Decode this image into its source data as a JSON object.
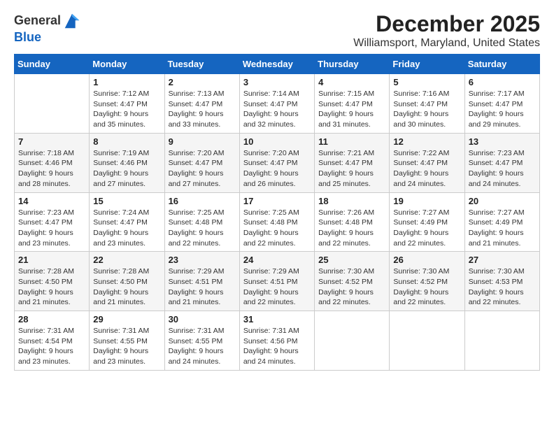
{
  "header": {
    "logo_line1": "General",
    "logo_line2": "Blue",
    "month": "December 2025",
    "location": "Williamsport, Maryland, United States"
  },
  "weekdays": [
    "Sunday",
    "Monday",
    "Tuesday",
    "Wednesday",
    "Thursday",
    "Friday",
    "Saturday"
  ],
  "weeks": [
    [
      {
        "day": "",
        "sunrise": "",
        "sunset": "",
        "daylight": ""
      },
      {
        "day": "1",
        "sunrise": "Sunrise: 7:12 AM",
        "sunset": "Sunset: 4:47 PM",
        "daylight": "Daylight: 9 hours and 35 minutes."
      },
      {
        "day": "2",
        "sunrise": "Sunrise: 7:13 AM",
        "sunset": "Sunset: 4:47 PM",
        "daylight": "Daylight: 9 hours and 33 minutes."
      },
      {
        "day": "3",
        "sunrise": "Sunrise: 7:14 AM",
        "sunset": "Sunset: 4:47 PM",
        "daylight": "Daylight: 9 hours and 32 minutes."
      },
      {
        "day": "4",
        "sunrise": "Sunrise: 7:15 AM",
        "sunset": "Sunset: 4:47 PM",
        "daylight": "Daylight: 9 hours and 31 minutes."
      },
      {
        "day": "5",
        "sunrise": "Sunrise: 7:16 AM",
        "sunset": "Sunset: 4:47 PM",
        "daylight": "Daylight: 9 hours and 30 minutes."
      },
      {
        "day": "6",
        "sunrise": "Sunrise: 7:17 AM",
        "sunset": "Sunset: 4:47 PM",
        "daylight": "Daylight: 9 hours and 29 minutes."
      }
    ],
    [
      {
        "day": "7",
        "sunrise": "Sunrise: 7:18 AM",
        "sunset": "Sunset: 4:46 PM",
        "daylight": "Daylight: 9 hours and 28 minutes."
      },
      {
        "day": "8",
        "sunrise": "Sunrise: 7:19 AM",
        "sunset": "Sunset: 4:46 PM",
        "daylight": "Daylight: 9 hours and 27 minutes."
      },
      {
        "day": "9",
        "sunrise": "Sunrise: 7:20 AM",
        "sunset": "Sunset: 4:47 PM",
        "daylight": "Daylight: 9 hours and 27 minutes."
      },
      {
        "day": "10",
        "sunrise": "Sunrise: 7:20 AM",
        "sunset": "Sunset: 4:47 PM",
        "daylight": "Daylight: 9 hours and 26 minutes."
      },
      {
        "day": "11",
        "sunrise": "Sunrise: 7:21 AM",
        "sunset": "Sunset: 4:47 PM",
        "daylight": "Daylight: 9 hours and 25 minutes."
      },
      {
        "day": "12",
        "sunrise": "Sunrise: 7:22 AM",
        "sunset": "Sunset: 4:47 PM",
        "daylight": "Daylight: 9 hours and 24 minutes."
      },
      {
        "day": "13",
        "sunrise": "Sunrise: 7:23 AM",
        "sunset": "Sunset: 4:47 PM",
        "daylight": "Daylight: 9 hours and 24 minutes."
      }
    ],
    [
      {
        "day": "14",
        "sunrise": "Sunrise: 7:23 AM",
        "sunset": "Sunset: 4:47 PM",
        "daylight": "Daylight: 9 hours and 23 minutes."
      },
      {
        "day": "15",
        "sunrise": "Sunrise: 7:24 AM",
        "sunset": "Sunset: 4:47 PM",
        "daylight": "Daylight: 9 hours and 23 minutes."
      },
      {
        "day": "16",
        "sunrise": "Sunrise: 7:25 AM",
        "sunset": "Sunset: 4:48 PM",
        "daylight": "Daylight: 9 hours and 22 minutes."
      },
      {
        "day": "17",
        "sunrise": "Sunrise: 7:25 AM",
        "sunset": "Sunset: 4:48 PM",
        "daylight": "Daylight: 9 hours and 22 minutes."
      },
      {
        "day": "18",
        "sunrise": "Sunrise: 7:26 AM",
        "sunset": "Sunset: 4:48 PM",
        "daylight": "Daylight: 9 hours and 22 minutes."
      },
      {
        "day": "19",
        "sunrise": "Sunrise: 7:27 AM",
        "sunset": "Sunset: 4:49 PM",
        "daylight": "Daylight: 9 hours and 22 minutes."
      },
      {
        "day": "20",
        "sunrise": "Sunrise: 7:27 AM",
        "sunset": "Sunset: 4:49 PM",
        "daylight": "Daylight: 9 hours and 21 minutes."
      }
    ],
    [
      {
        "day": "21",
        "sunrise": "Sunrise: 7:28 AM",
        "sunset": "Sunset: 4:50 PM",
        "daylight": "Daylight: 9 hours and 21 minutes."
      },
      {
        "day": "22",
        "sunrise": "Sunrise: 7:28 AM",
        "sunset": "Sunset: 4:50 PM",
        "daylight": "Daylight: 9 hours and 21 minutes."
      },
      {
        "day": "23",
        "sunrise": "Sunrise: 7:29 AM",
        "sunset": "Sunset: 4:51 PM",
        "daylight": "Daylight: 9 hours and 21 minutes."
      },
      {
        "day": "24",
        "sunrise": "Sunrise: 7:29 AM",
        "sunset": "Sunset: 4:51 PM",
        "daylight": "Daylight: 9 hours and 22 minutes."
      },
      {
        "day": "25",
        "sunrise": "Sunrise: 7:30 AM",
        "sunset": "Sunset: 4:52 PM",
        "daylight": "Daylight: 9 hours and 22 minutes."
      },
      {
        "day": "26",
        "sunrise": "Sunrise: 7:30 AM",
        "sunset": "Sunset: 4:52 PM",
        "daylight": "Daylight: 9 hours and 22 minutes."
      },
      {
        "day": "27",
        "sunrise": "Sunrise: 7:30 AM",
        "sunset": "Sunset: 4:53 PM",
        "daylight": "Daylight: 9 hours and 22 minutes."
      }
    ],
    [
      {
        "day": "28",
        "sunrise": "Sunrise: 7:31 AM",
        "sunset": "Sunset: 4:54 PM",
        "daylight": "Daylight: 9 hours and 23 minutes."
      },
      {
        "day": "29",
        "sunrise": "Sunrise: 7:31 AM",
        "sunset": "Sunset: 4:55 PM",
        "daylight": "Daylight: 9 hours and 23 minutes."
      },
      {
        "day": "30",
        "sunrise": "Sunrise: 7:31 AM",
        "sunset": "Sunset: 4:55 PM",
        "daylight": "Daylight: 9 hours and 24 minutes."
      },
      {
        "day": "31",
        "sunrise": "Sunrise: 7:31 AM",
        "sunset": "Sunset: 4:56 PM",
        "daylight": "Daylight: 9 hours and 24 minutes."
      },
      {
        "day": "",
        "sunrise": "",
        "sunset": "",
        "daylight": ""
      },
      {
        "day": "",
        "sunrise": "",
        "sunset": "",
        "daylight": ""
      },
      {
        "day": "",
        "sunrise": "",
        "sunset": "",
        "daylight": ""
      }
    ]
  ]
}
